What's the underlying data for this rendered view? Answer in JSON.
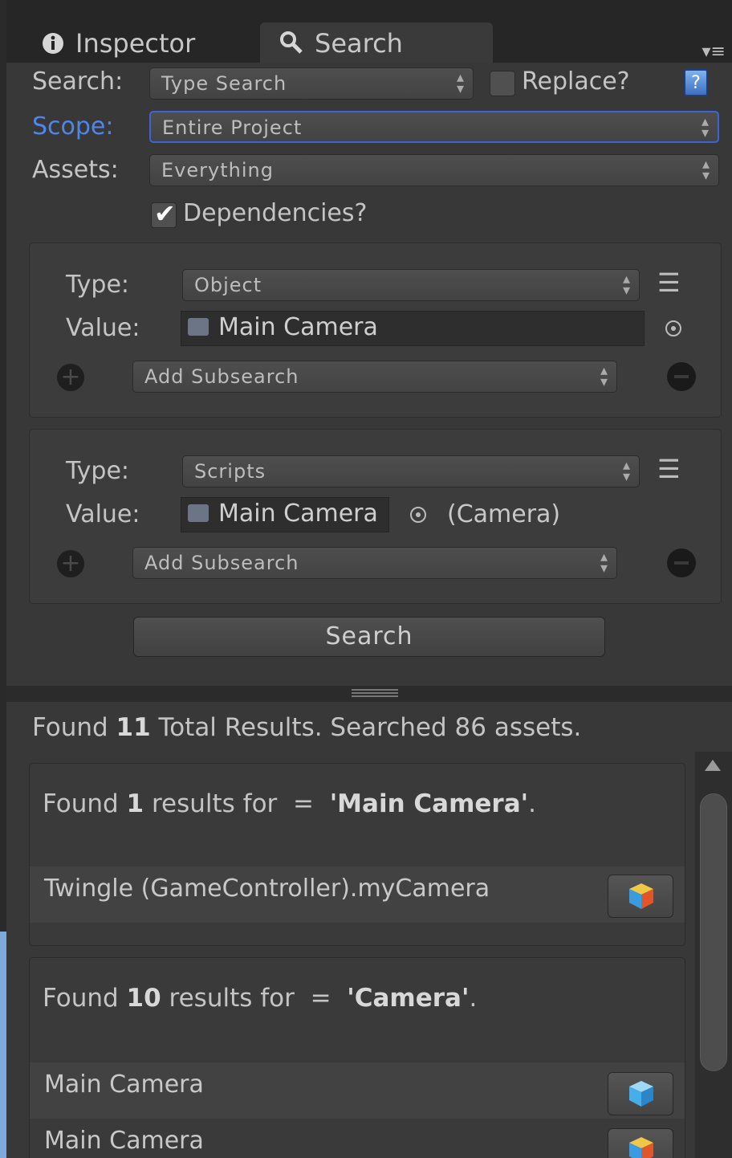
{
  "tabs": [
    {
      "icon": "info-icon",
      "label": "Inspector"
    },
    {
      "icon": "search-icon",
      "label": "Search"
    }
  ],
  "search_row": {
    "label": "Search:",
    "dropdown": "Type Search",
    "replace_label": "Replace?",
    "replace_checked": false
  },
  "scope_row": {
    "label": "Scope:",
    "dropdown": "Entire Project"
  },
  "assets_row": {
    "label": "Assets:",
    "dropdown": "Everything"
  },
  "dependencies": {
    "label": "Dependencies?",
    "checked": true
  },
  "subsearch_1": {
    "type_label": "Type:",
    "type_value": "Object",
    "value_label": "Value:",
    "value": "Main Camera",
    "add_subsearch": "Add Subsearch"
  },
  "subsearch_2": {
    "type_label": "Type:",
    "type_value": "Scripts",
    "value_label": "Value:",
    "value": "Main Camera",
    "component": "(Camera)",
    "add_subsearch": "Add Subsearch"
  },
  "search_button": "Search",
  "summary": {
    "prefix": "Found ",
    "count": "11",
    "suffix": " Total Results. Searched 86 assets."
  },
  "result_groups": [
    {
      "prefix": "Found ",
      "count": "1",
      "mid": " results for  =  ",
      "query": "'Main Camera'",
      "end": ".",
      "rows": [
        {
          "text": "Twingle (GameController).myCamera",
          "icon": "prefab-cube-icon"
        }
      ]
    },
    {
      "prefix": "Found ",
      "count": "10",
      "mid": " results for  =  ",
      "query": "'Camera'",
      "end": ".",
      "rows": [
        {
          "text": "Main Camera",
          "icon": "gameobject-cube-icon"
        },
        {
          "text": "Main Camera",
          "icon": "prefab-cube-icon"
        }
      ]
    }
  ],
  "colors": {
    "accent": "#4f86ea",
    "panel": "#383838",
    "text": "#c4c4c4"
  }
}
